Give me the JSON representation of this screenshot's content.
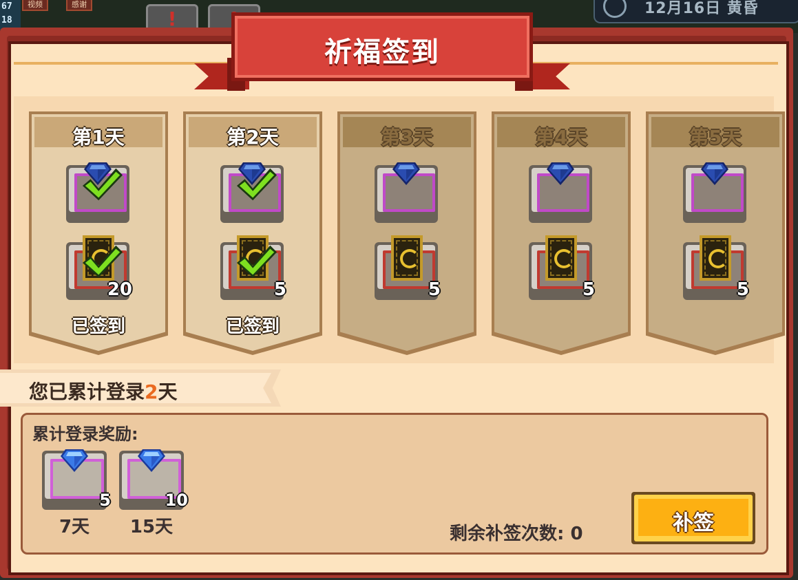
{
  "hud": {
    "stat_top": "67",
    "stat_bottom": "18",
    "tab1": "视频",
    "tab2": "感谢",
    "alert_mark": "!",
    "alert_mark2": "!",
    "weather_text": "12月16日 黄昏"
  },
  "dialog": {
    "title": "祈福签到"
  },
  "days": [
    {
      "label": "第1天",
      "status": "已签到",
      "gem_claimed": true,
      "card_count": "20",
      "card_claimed": true
    },
    {
      "label": "第2天",
      "status": "已签到",
      "gem_claimed": true,
      "card_count": "5",
      "card_claimed": true
    },
    {
      "label": "第3天",
      "status": "",
      "gem_claimed": false,
      "card_count": "5",
      "card_claimed": false
    },
    {
      "label": "第4天",
      "status": "",
      "gem_claimed": false,
      "card_count": "5",
      "card_claimed": false
    },
    {
      "label": "第5天",
      "status": "",
      "gem_claimed": false,
      "card_count": "5",
      "card_claimed": false
    }
  ],
  "login": {
    "prefix": "您已累计登录",
    "days": "2",
    "suffix": "天"
  },
  "cumulative": {
    "title": "累计登录奖励:",
    "rewards": [
      {
        "count": "5",
        "label": "7天"
      },
      {
        "count": "10",
        "label": "15天"
      }
    ],
    "remaining_text": "剩余补签次数: 0",
    "button_label": "补签"
  },
  "colors": {
    "accent_red": "#d8423a",
    "panel": "#fde4c0",
    "button": "#fdb012",
    "highlight": "#ea6a20"
  },
  "icons": {
    "gem": "blue-diamond-icon",
    "card": "moon-card-icon",
    "check": "green-check-icon"
  }
}
